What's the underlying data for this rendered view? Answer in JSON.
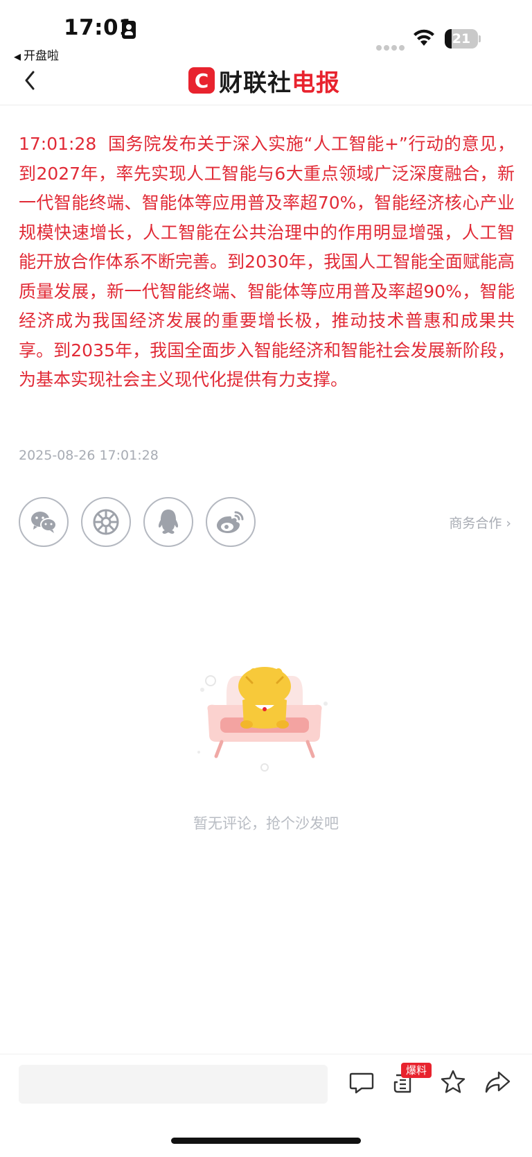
{
  "status_bar": {
    "time": "17:01",
    "back_app": "开盘啦",
    "battery": "21",
    "battery_level_percent": 21
  },
  "nav": {
    "logo_badge": "C",
    "logo_text_1": "财联社",
    "logo_text_2": "电报"
  },
  "article": {
    "time": "17:01:28",
    "body": "国务院发布关于深入实施“人工智能+”行动的意见，到2027年，率先实现人工智能与6大重点领域广泛深度融合，新一代智能终端、智能体等应用普及率超70%，智能经济核心产业规模快速增长，人工智能在公共治理中的作用明显增强，人工智能开放合作体系不断完善。到2030年，我国人工智能全面赋能高质量发展，新一代智能终端、智能体等应用普及率超90%，智能经济成为我国经济发展的重要增长极，推动技术普惠和成果共享。到2035年，我国全面步入智能经济和智能社会发展新阶段，为基本实现社会主义现代化提供有力支撑。",
    "date": "2025-08-26 17:01:28"
  },
  "share": {
    "icons": [
      "wechat-icon",
      "moments-icon",
      "qq-icon",
      "weibo-icon"
    ],
    "business_link": "商务合作 ›"
  },
  "comments": {
    "empty_text": "暂无评论，抢个沙发吧"
  },
  "toolbar": {
    "input_placeholder": "",
    "scoop_badge": "爆料"
  },
  "colors": {
    "brand_red": "#e8232e",
    "article_red": "#e12a36",
    "muted_gray": "#a8acb4"
  }
}
